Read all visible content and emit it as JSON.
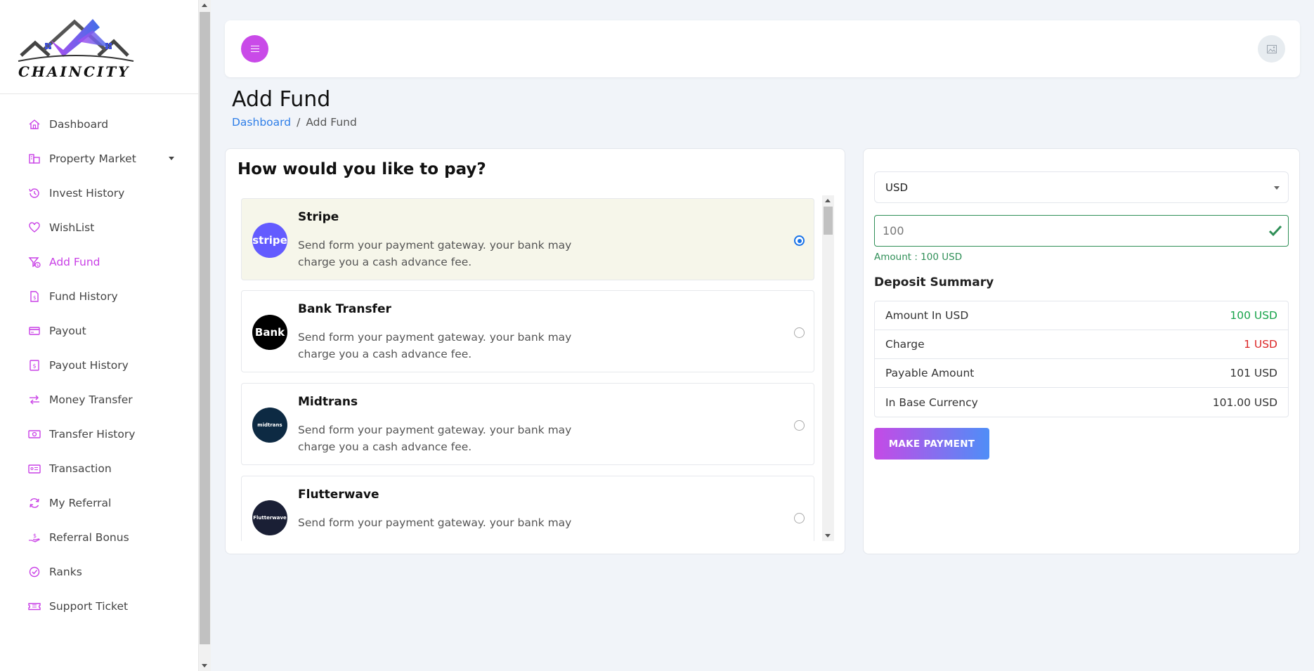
{
  "brand": {
    "name": "CHAINCITY"
  },
  "sidebar": {
    "items": [
      {
        "label": "Dashboard",
        "icon": "house-icon"
      },
      {
        "label": "Property Market",
        "icon": "property-icon"
      },
      {
        "label": "Invest History",
        "icon": "history-icon"
      },
      {
        "label": "WishList",
        "icon": "heart-icon"
      },
      {
        "label": "Add Fund",
        "icon": "funnel-dollar-icon",
        "active": true
      },
      {
        "label": "Fund History",
        "icon": "file-dollar-icon"
      },
      {
        "label": "Payout",
        "icon": "credit-card-icon"
      },
      {
        "label": "Payout History",
        "icon": "receipt-icon"
      },
      {
        "label": "Money Transfer",
        "icon": "transfer-icon"
      },
      {
        "label": "Transfer History",
        "icon": "cash-icon"
      },
      {
        "label": "Transaction",
        "icon": "id-card-icon"
      },
      {
        "label": "My Referral",
        "icon": "refresh-icon"
      },
      {
        "label": "Referral Bonus",
        "icon": "hand-dollar-icon"
      },
      {
        "label": "Ranks",
        "icon": "badge-icon"
      },
      {
        "label": "Support Ticket",
        "icon": "ticket-icon"
      }
    ]
  },
  "header": {
    "page_title": "Add Fund",
    "breadcrumb": {
      "home": "Dashboard",
      "separator": "/",
      "current": "Add Fund"
    }
  },
  "payment": {
    "title": "How would you like to pay?",
    "gateways": [
      {
        "name": "Stripe",
        "logo_text": "stripe",
        "logo_color": "#635bff",
        "description": "Send form your payment gateway. your bank may charge you a cash advance fee.",
        "selected": true
      },
      {
        "name": "Bank Transfer",
        "logo_text": "Bank",
        "logo_color": "#000000",
        "description": "Send form your payment gateway. your bank may charge you a cash advance fee.",
        "selected": false
      },
      {
        "name": "Midtrans",
        "logo_text": "midtrans",
        "logo_color": "#0d2a43",
        "description": "Send form your payment gateway. your bank may charge you a cash advance fee.",
        "selected": false
      },
      {
        "name": "Flutterwave",
        "logo_text": "Flutterwave",
        "logo_color": "#1a1f35",
        "description": "Send form your payment gateway. your bank may",
        "selected": false
      }
    ]
  },
  "summary": {
    "currency": "USD",
    "amount_value": "100",
    "amount_note": "Amount : 100 USD",
    "title": "Deposit Summary",
    "rows": [
      {
        "label": "Amount In USD",
        "value": "100 USD",
        "color": "#17a34a"
      },
      {
        "label": "Charge",
        "value": "1 USD",
        "color": "#dc2626"
      },
      {
        "label": "Payable Amount",
        "value": "101 USD",
        "color": "#333333"
      },
      {
        "label": "In Base Currency",
        "value": "101.00 USD",
        "color": "#333333"
      }
    ],
    "button_label": "MAKE PAYMENT"
  },
  "colors": {
    "accent": "#c940e6",
    "success": "#2f8f57",
    "link": "#2e7ee8"
  }
}
